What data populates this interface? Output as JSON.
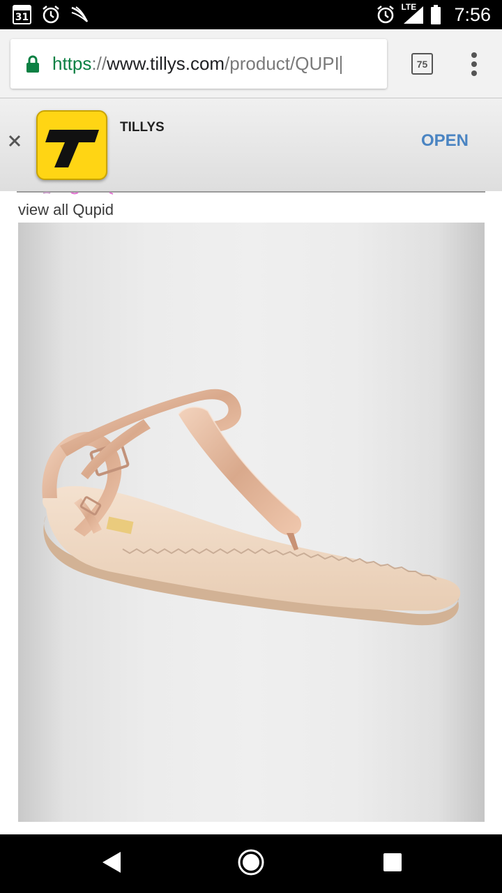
{
  "status_bar": {
    "calendar_day": "31",
    "network_label": "LTE",
    "time": "7:56",
    "left_icons": [
      "calendar-icon",
      "alarm-icon",
      "sprint-logo-icon"
    ],
    "right_icons": [
      "alarm-icon",
      "signal-icon",
      "battery-icon"
    ]
  },
  "browser": {
    "url_scheme": "https",
    "url_separator": "://",
    "url_host": "www.tillys.com",
    "url_path": "/product/QUPI",
    "tab_count": "75",
    "lock_color": "#0b8043"
  },
  "app_banner": {
    "app_name": "TILLYS",
    "open_label": "OPEN",
    "icon_color": "#ffd514",
    "open_color": "#4a84c2"
  },
  "page": {
    "view_all_link": "view all Qupid",
    "product_image_subject": "rose gold metallic T-strap thong sandal with ankle buckle"
  },
  "nav_bar": {
    "buttons": [
      "back-icon",
      "home-icon",
      "recents-icon"
    ]
  }
}
